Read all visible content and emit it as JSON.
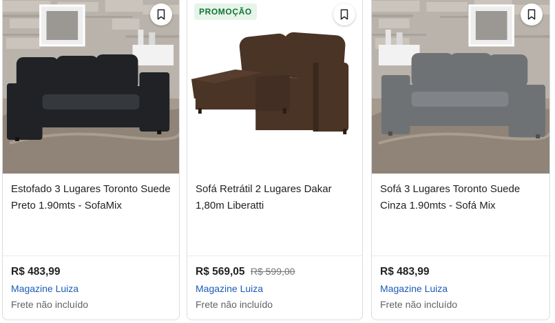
{
  "products": [
    {
      "title": "Estofado 3 Lugares Toronto Suede Preto 1.90mts - SofaMix",
      "price": "R$ 483,99",
      "store": "Magazine Luiza",
      "shipping": "Frete não incluído",
      "sofa_color": "#202226",
      "bookmark_icon": "bookmark-outline-icon"
    },
    {
      "badge": "PROMOÇÃO",
      "title": "Sofá Retrátil 2 Lugares Dakar 1,80m Liberatti",
      "price": "R$ 569,05",
      "old_price": "R$ 599,00",
      "store": "Magazine Luiza",
      "shipping": "Frete não incluído",
      "sofa_color": "#4a3426",
      "bookmark_icon": "bookmark-outline-icon"
    },
    {
      "title": "Sofá 3 Lugares Toronto Suede Cinza 1.90mts - Sofá Mix",
      "price": "R$ 483,99",
      "store": "Magazine Luiza",
      "shipping": "Frete não incluído",
      "sofa_color": "#6f7275",
      "bookmark_icon": "bookmark-outline-icon"
    }
  ],
  "colors": {
    "store_link": "#1a5bb8",
    "promo_bg": "#e6f4ea",
    "promo_text": "#137333",
    "card_border": "#dadce0"
  }
}
